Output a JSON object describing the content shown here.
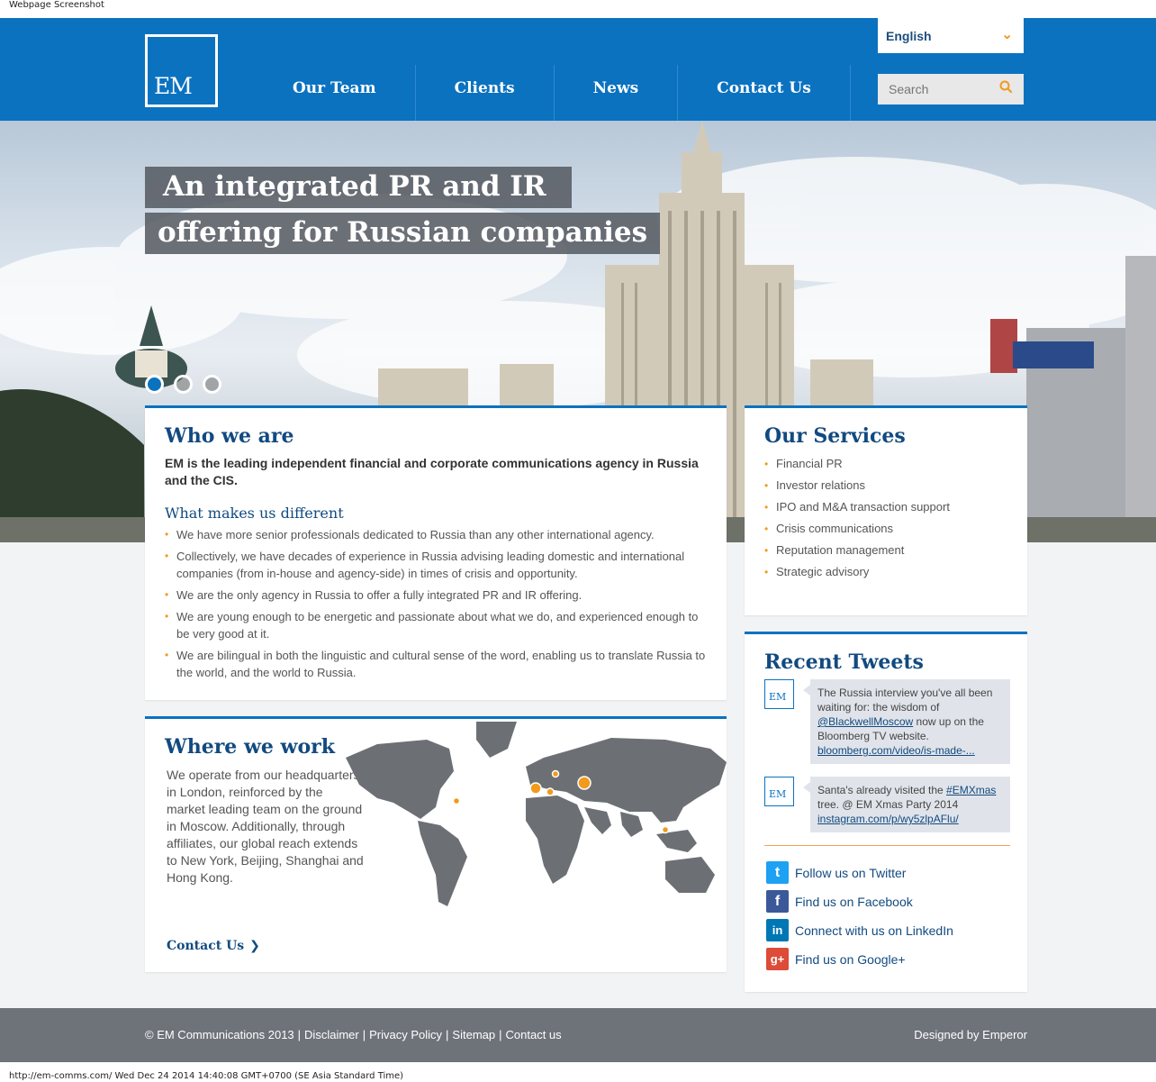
{
  "screenshot_caption": "Webpage Screenshot",
  "header": {
    "logo_text": "EM",
    "nav": [
      {
        "label": "Our Team"
      },
      {
        "label": "Clients"
      },
      {
        "label": "News"
      },
      {
        "label": "Contact Us"
      }
    ],
    "language": {
      "selected": "English"
    },
    "search": {
      "placeholder": "Search"
    }
  },
  "hero": {
    "title_line1": "An integrated PR and IR",
    "title_line2": "offering for Russian companies",
    "slides": 3,
    "active_slide": 1
  },
  "who_we_are": {
    "title": "Who we are",
    "lead": "EM is the leading independent financial and corporate communications agency in Russia and the CIS.",
    "subtitle": "What makes us different",
    "points": [
      "We have more senior professionals dedicated to Russia than any other international agency.",
      "Collectively, we have decades of experience in Russia advising leading domestic and international companies (from in-house and agency-side) in times of crisis and opportunity.",
      "We are the only agency in Russia to offer a fully integrated PR and IR offering.",
      "We are young enough to be energetic and passionate about what we do, and experienced enough to be very good at it.",
      "We are bilingual in both the linguistic and cultural sense of the word, enabling us to translate Russia to the world, and the world to Russia."
    ]
  },
  "where_we_work": {
    "title": "Where we work",
    "text": "We operate from our headquarters in London, reinforced by the market leading team on the ground in Moscow.  Additionally, through affiliates, our global reach extends to New York, Beijing, Shanghai and Hong Kong.",
    "cta": "Contact Us"
  },
  "services": {
    "title": "Our Services",
    "items": [
      "Financial PR",
      "Investor relations",
      "IPO and M&A transaction support",
      "Crisis communications",
      "Reputation management",
      "Strategic advisory"
    ]
  },
  "tweets": {
    "title": "Recent Tweets",
    "avatar_text": "EM",
    "items": [
      {
        "text_before": "The Russia interview you've all been waiting for: the wisdom of ",
        "handle": "@BlackwellMoscow",
        "text_after": " now up on the Bloomberg TV website. ",
        "link": "bloomberg.com/video/is-made-..."
      },
      {
        "text_before": "Santa's already visited the ",
        "handle": "#EMXmas",
        "text_after": " tree. @ EM Xmas Party 2014 ",
        "link": "instagram.com/p/wy5zlpAFlu/"
      }
    ],
    "social": [
      {
        "icon": "twitter-icon",
        "label": "Follow us on Twitter",
        "color": "#1da1f2",
        "glyph": "t"
      },
      {
        "icon": "facebook-icon",
        "label": "Find us on Facebook",
        "color": "#3b5998",
        "glyph": "f"
      },
      {
        "icon": "linkedin-icon",
        "label": "Connect with us on LinkedIn",
        "color": "#0077b5",
        "glyph": "in"
      },
      {
        "icon": "googleplus-icon",
        "label": "Find us on Google+",
        "color": "#dd4b39",
        "glyph": "g+"
      }
    ]
  },
  "footer": {
    "copyright": "© EM Communications 2013",
    "links": [
      "Disclaimer",
      "Privacy Policy",
      "Sitemap",
      "Contact us"
    ],
    "credit": "Designed by Emperor"
  },
  "status_bar": "http://em-comms.com/ Wed Dec 24 2014 14:40:08 GMT+0700 (SE Asia Standard Time)",
  "colors": {
    "brand_blue": "#0b72c0",
    "accent_orange": "#f29a1c",
    "heading_navy": "#124a80",
    "footer_grey": "#6e737a"
  }
}
